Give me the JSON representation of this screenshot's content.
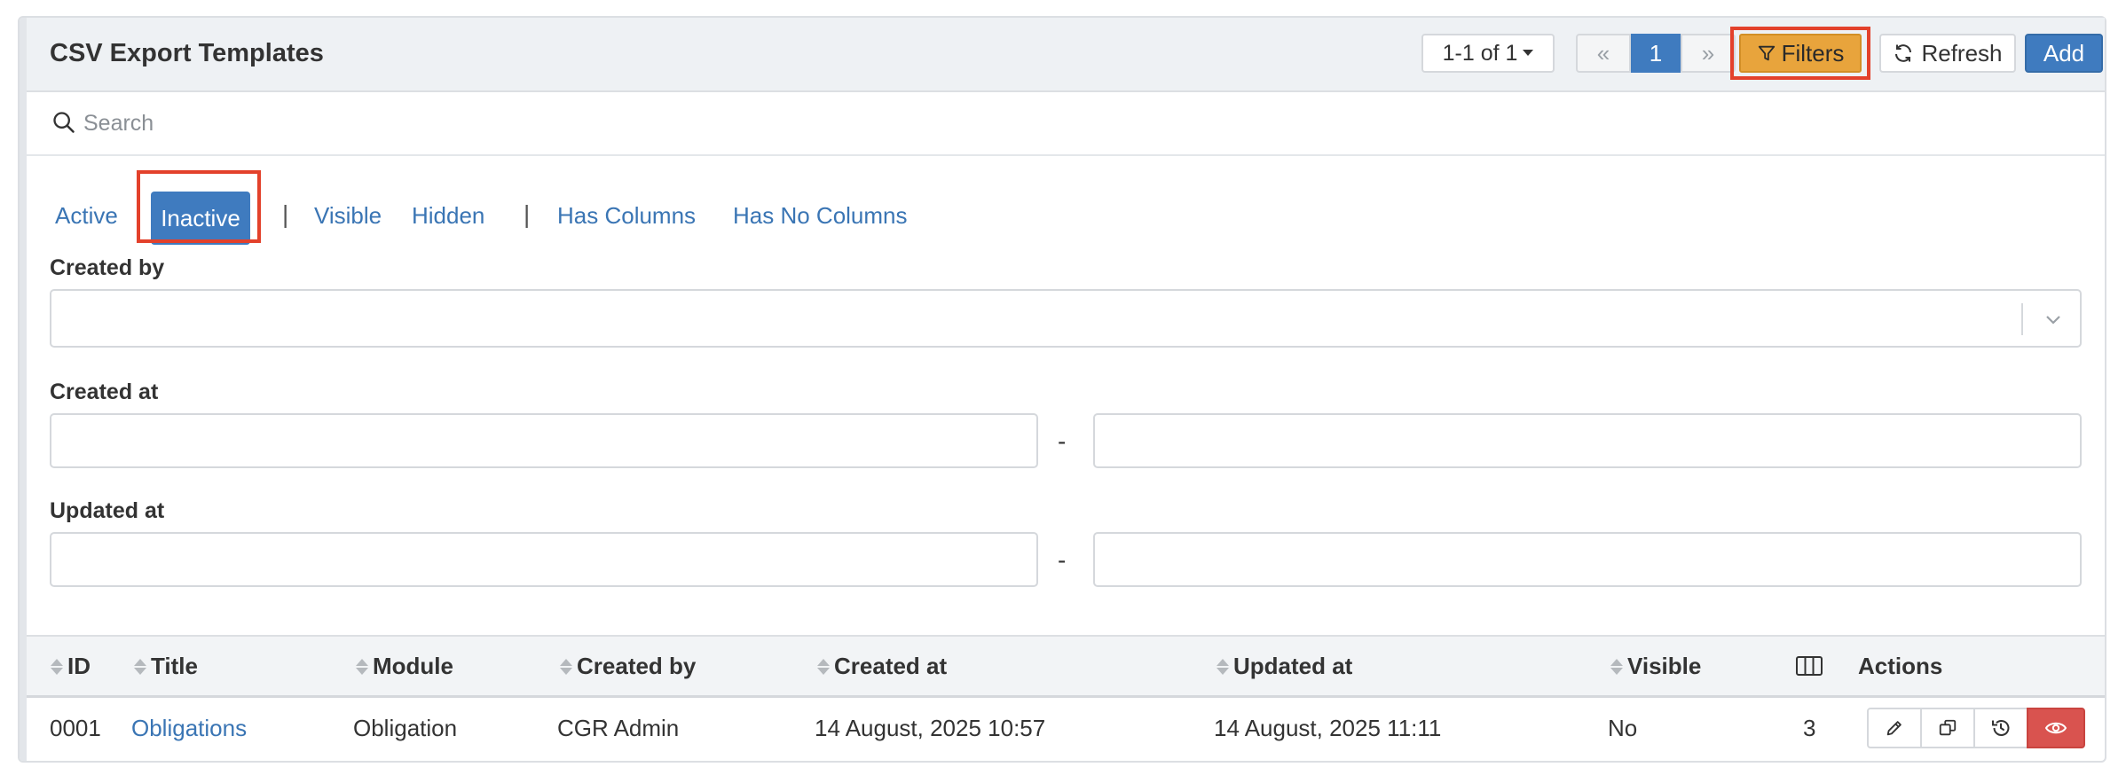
{
  "header": {
    "title": "CSV Export Templates",
    "pagination": {
      "count_label": "1-1 of 1",
      "first_label": "«",
      "current_page": "1",
      "last_label": "»"
    },
    "filters_label": "Filters",
    "refresh_label": "Refresh",
    "add_label": "Add"
  },
  "search": {
    "placeholder": "Search",
    "value": ""
  },
  "tabs": {
    "active": "Active",
    "inactive": "Inactive",
    "separator": "|",
    "visible": "Visible",
    "hidden": "Hidden",
    "has_columns": "Has Columns",
    "has_no_columns": "Has No Columns",
    "selected": "Inactive"
  },
  "filters": {
    "created_by_label": "Created by",
    "created_by_value": "",
    "created_at_label": "Created at",
    "updated_at_label": "Updated at",
    "range_separator": "-"
  },
  "table": {
    "columns": [
      "ID",
      "Title",
      "Module",
      "Created by",
      "Created at",
      "Updated at",
      "Visible",
      "Actions"
    ],
    "rows": [
      {
        "id": "0001",
        "title": "Obligations",
        "module": "Obligation",
        "created_by": "CGR Admin",
        "created_at": "14 August, 2025 10:57",
        "updated_at": "14 August, 2025 11:11",
        "visible": "No",
        "columns_count": "3",
        "actions": [
          "edit-icon",
          "copy-icon",
          "history-icon",
          "hidden-eye-icon"
        ]
      }
    ]
  },
  "colors": {
    "primary": "#3f7bbf",
    "filters": "#e8a43c",
    "danger": "#d9534f",
    "highlight": "#e3412b",
    "link": "#3a75b4"
  }
}
